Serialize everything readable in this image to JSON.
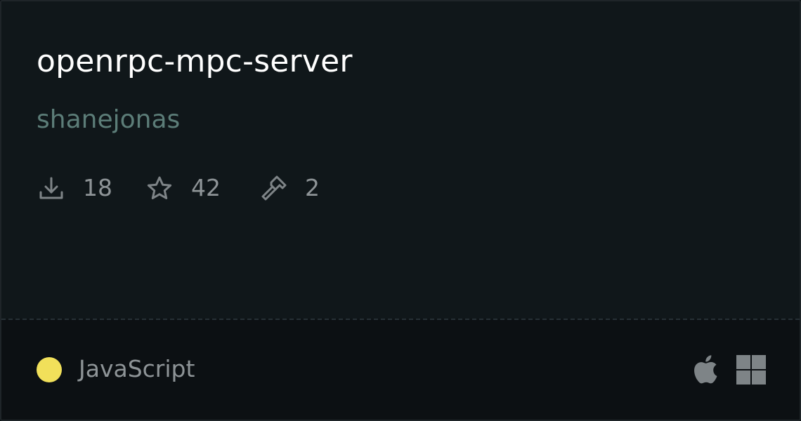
{
  "package": {
    "name": "openrpc-mpc-server",
    "author": "shanejonas"
  },
  "stats": [
    {
      "icon": "download-icon",
      "value": "18"
    },
    {
      "icon": "star-icon",
      "value": "42"
    },
    {
      "icon": "hammer-icon",
      "value": "2"
    }
  ],
  "footer": {
    "language": "JavaScript",
    "language_color": "#f1e05a",
    "platforms": [
      "apple-icon",
      "windows-icon"
    ]
  },
  "colors": {
    "title": "#ffffff",
    "author": "#5c7d78",
    "muted": "#8e9497",
    "icon": "#7e8487"
  }
}
